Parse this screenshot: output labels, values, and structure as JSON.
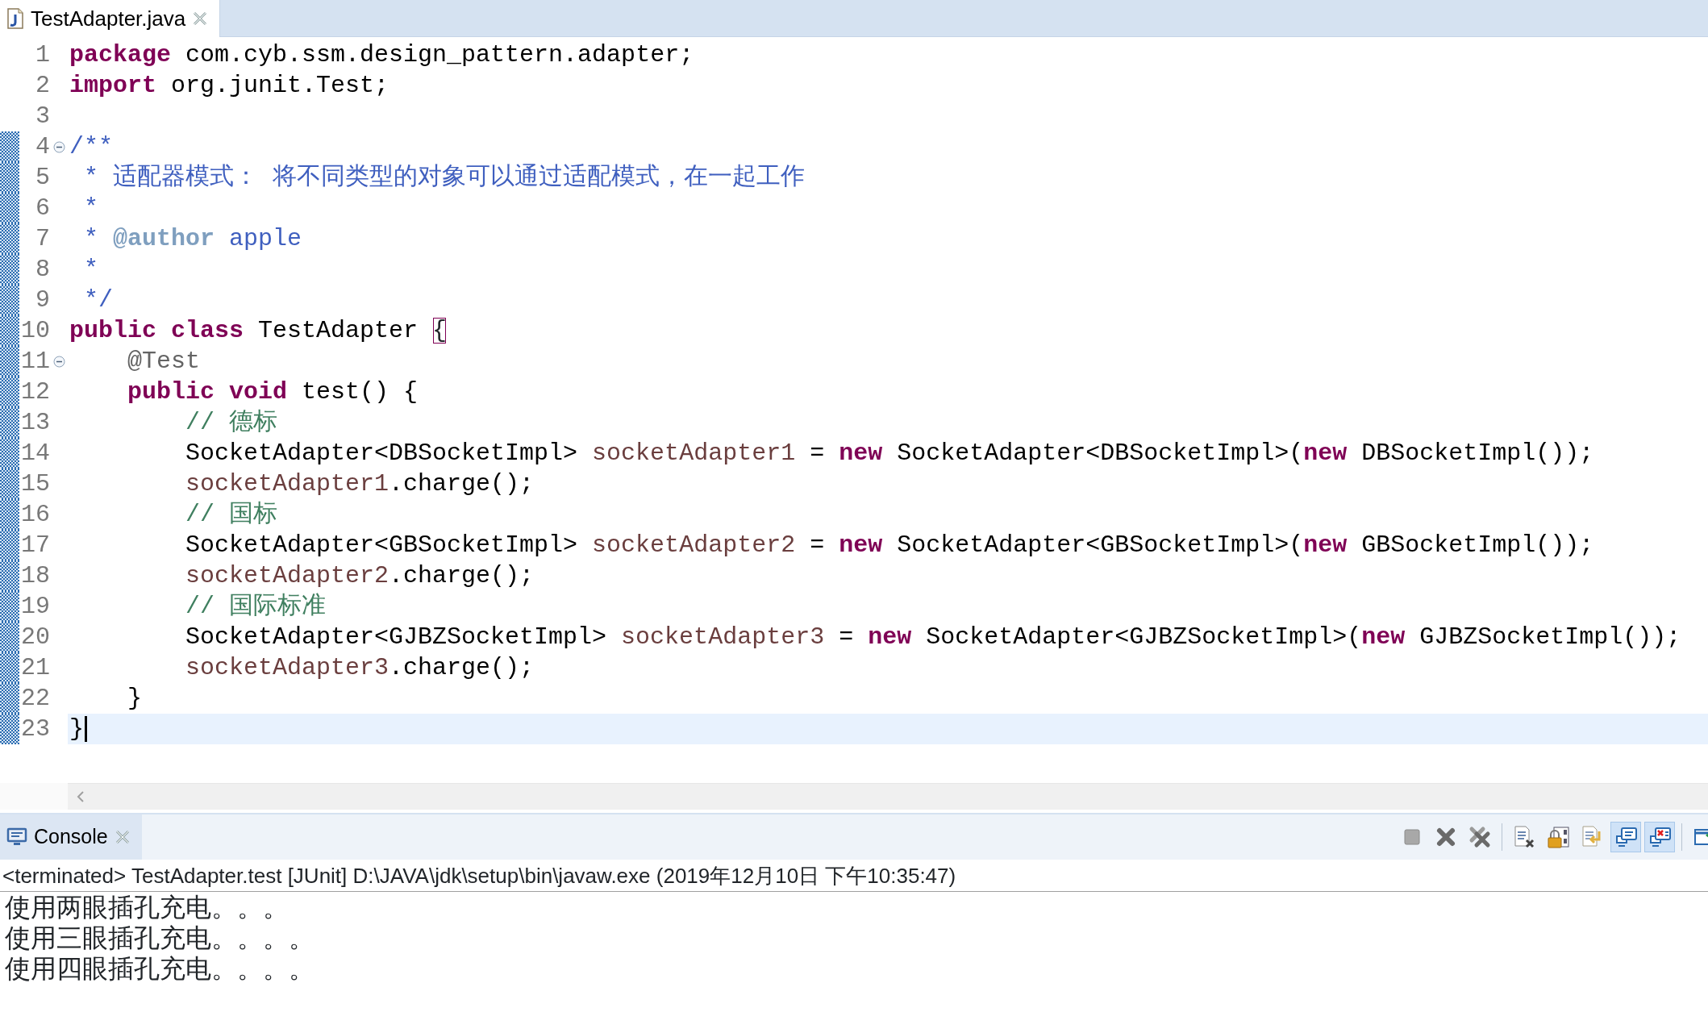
{
  "editor": {
    "tabs": [
      {
        "title": "TestAdapter.java",
        "selected": true
      }
    ],
    "lines": [
      {
        "number": "1",
        "changed": false,
        "tokens": [
          {
            "kind": "keyword",
            "text": "package"
          },
          {
            "kind": "plain",
            "text": " com.cyb.ssm.design_pattern.adapter;"
          }
        ]
      },
      {
        "number": "2",
        "changed": false,
        "tokens": [
          {
            "kind": "keyword",
            "text": "import"
          },
          {
            "kind": "plain",
            "text": " org.junit.Test;"
          }
        ]
      },
      {
        "number": "3",
        "changed": false
      },
      {
        "number": "4",
        "changed": true,
        "expanded": true,
        "tokens": [
          {
            "kind": "doc",
            "text": "/**"
          }
        ]
      },
      {
        "number": "5",
        "changed": true,
        "tokens": [
          {
            "kind": "doc",
            "text": " * 适配器模式： 将不同类型的对象可以通过适配模式，在一起工作"
          }
        ]
      },
      {
        "number": "6",
        "changed": true,
        "tokens": [
          {
            "kind": "doc",
            "text": " *"
          }
        ]
      },
      {
        "number": "7",
        "changed": true,
        "tokens": [
          {
            "kind": "doc",
            "text": " * "
          },
          {
            "kind": "doc-tag",
            "text": "@author"
          },
          {
            "kind": "doc",
            "text": " apple"
          }
        ]
      },
      {
        "number": "8",
        "changed": true,
        "tokens": [
          {
            "kind": "doc",
            "text": " *"
          }
        ]
      },
      {
        "number": "9",
        "changed": true,
        "tokens": [
          {
            "kind": "doc",
            "text": " */"
          }
        ]
      },
      {
        "number": "10",
        "changed": true,
        "tokens": [
          {
            "kind": "keyword",
            "text": "public class"
          },
          {
            "kind": "plain",
            "text": " TestAdapter "
          },
          {
            "kind": "matched-bracket",
            "text": "{"
          }
        ],
        "children": [
          {
            "number": "11",
            "changed": true,
            "expanded": true,
            "tokens": [
              {
                "kind": "annotation",
                "text": "@Test"
              }
            ]
          },
          {
            "number": "12",
            "changed": true,
            "tokens": [
              {
                "kind": "keyword",
                "text": "public void"
              },
              {
                "kind": "plain",
                "text": " test() {"
              }
            ],
            "children": [
              {
                "number": "13",
                "changed": true,
                "tokens": [
                  {
                    "kind": "comment",
                    "text": "// 德标"
                  }
                ]
              },
              {
                "number": "14",
                "changed": true,
                "tokens": [
                  {
                    "kind": "plain",
                    "text": "SocketAdapter<DBSocketImpl> "
                  },
                  {
                    "kind": "variable",
                    "text": "socketAdapter1"
                  },
                  {
                    "kind": "plain",
                    "text": " = "
                  },
                  {
                    "kind": "keyword",
                    "text": "new"
                  },
                  {
                    "kind": "plain",
                    "text": " SocketAdapter<DBSocketImpl>("
                  },
                  {
                    "kind": "keyword",
                    "text": "new"
                  },
                  {
                    "kind": "plain",
                    "text": " DBSocketImpl());"
                  }
                ]
              },
              {
                "number": "15",
                "changed": true,
                "tokens": [
                  {
                    "kind": "variable",
                    "text": "socketAdapter1"
                  },
                  {
                    "kind": "plain",
                    "text": ".charge();"
                  }
                ]
              },
              {
                "number": "16",
                "changed": true,
                "tokens": [
                  {
                    "kind": "comment",
                    "text": "// 国标"
                  }
                ]
              },
              {
                "number": "17",
                "changed": true,
                "tokens": [
                  {
                    "kind": "plain",
                    "text": "SocketAdapter<GBSocketImpl> "
                  },
                  {
                    "kind": "variable",
                    "text": "socketAdapter2"
                  },
                  {
                    "kind": "plain",
                    "text": " = "
                  },
                  {
                    "kind": "keyword",
                    "text": "new"
                  },
                  {
                    "kind": "plain",
                    "text": " SocketAdapter<GBSocketImpl>("
                  },
                  {
                    "kind": "keyword",
                    "text": "new"
                  },
                  {
                    "kind": "plain",
                    "text": " GBSocketImpl());"
                  }
                ]
              },
              {
                "number": "18",
                "changed": true,
                "tokens": [
                  {
                    "kind": "variable",
                    "text": "socketAdapter2"
                  },
                  {
                    "kind": "plain",
                    "text": ".charge();"
                  }
                ]
              },
              {
                "number": "19",
                "changed": true,
                "tokens": [
                  {
                    "kind": "comment",
                    "text": "// 国际标准"
                  }
                ]
              },
              {
                "number": "20",
                "changed": true,
                "tokens": [
                  {
                    "kind": "plain",
                    "text": "SocketAdapter<GJBZSocketImpl> "
                  },
                  {
                    "kind": "variable",
                    "text": "socketAdapter3"
                  },
                  {
                    "kind": "plain",
                    "text": " = "
                  },
                  {
                    "kind": "keyword",
                    "text": "new"
                  },
                  {
                    "kind": "plain",
                    "text": " SocketAdapter<GJBZSocketImpl>("
                  },
                  {
                    "kind": "keyword",
                    "text": "new"
                  },
                  {
                    "kind": "plain",
                    "text": " GJBZSocketImpl());"
                  }
                ]
              },
              {
                "number": "21",
                "changed": true,
                "tokens": [
                  {
                    "kind": "variable",
                    "text": "socketAdapter3"
                  },
                  {
                    "kind": "plain",
                    "text": ".charge();"
                  }
                ]
              }
            ]
          },
          {
            "number": "22",
            "changed": true,
            "tokens": [
              {
                "kind": "plain",
                "text": "}"
              }
            ]
          }
        ]
      },
      {
        "number": "23",
        "changed": true,
        "current": true,
        "cursor": true,
        "tokens": [
          {
            "kind": "plain",
            "text": "}"
          }
        ]
      }
    ]
  },
  "console": {
    "tab": {
      "title": "Console",
      "selected": true
    },
    "toolbar": [
      {
        "kind": "terminate",
        "selected": false
      },
      {
        "kind": "remove",
        "selected": false
      },
      {
        "kind": "remove-all",
        "selected": false
      },
      {
        "kind": "separator"
      },
      {
        "kind": "clear",
        "selected": false
      },
      {
        "kind": "scroll-lock",
        "selected": false
      },
      {
        "kind": "word-wrap",
        "selected": false
      },
      {
        "kind": "stdout",
        "selected": true
      },
      {
        "kind": "stderr",
        "selected": true
      },
      {
        "kind": "separator"
      },
      {
        "kind": "open-console",
        "selected": false
      }
    ],
    "status": "<terminated> TestAdapter.test [JUnit] D:\\JAVA\\jdk\\setup\\bin\\javaw.exe (2019年12月10日 下午10:35:47)",
    "output": [
      "使用两眼插孔充电。。。",
      "使用三眼插孔充电。。。。",
      "使用四眼插孔充电。。。。"
    ]
  }
}
